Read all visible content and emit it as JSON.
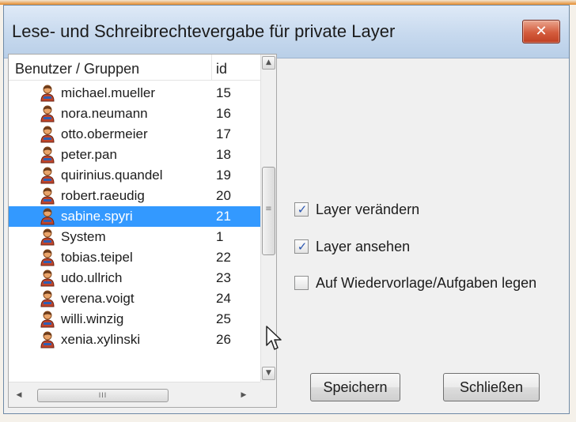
{
  "dialog": {
    "title": "Lese- und Schreibrechtevergabe für private Layer",
    "close_label": "✕"
  },
  "list": {
    "column_name": "Benutzer / Gruppen",
    "column_id": "id",
    "rows": [
      {
        "name": "michael.mueller",
        "id": "15",
        "selected": false
      },
      {
        "name": "nora.neumann",
        "id": "16",
        "selected": false
      },
      {
        "name": "otto.obermeier",
        "id": "17",
        "selected": false
      },
      {
        "name": "peter.pan",
        "id": "18",
        "selected": false
      },
      {
        "name": "quirinius.quandel",
        "id": "19",
        "selected": false
      },
      {
        "name": "robert.raeudig",
        "id": "20",
        "selected": false
      },
      {
        "name": "sabine.spyri",
        "id": "21",
        "selected": true
      },
      {
        "name": "System",
        "id": "1",
        "selected": false
      },
      {
        "name": "tobias.teipel",
        "id": "22",
        "selected": false
      },
      {
        "name": "udo.ullrich",
        "id": "23",
        "selected": false
      },
      {
        "name": "verena.voigt",
        "id": "24",
        "selected": false
      },
      {
        "name": "willi.winzig",
        "id": "25",
        "selected": false
      },
      {
        "name": "xenia.xylinski",
        "id": "26",
        "selected": false
      }
    ],
    "row_icon": "user-icon",
    "vscroll_grip": "≡",
    "hscroll_grip": "III"
  },
  "permissions": [
    {
      "label": "Layer verändern",
      "checked": true
    },
    {
      "label": "Layer ansehen",
      "checked": true
    },
    {
      "label": "Auf Wiedervorlage/Aufgaben legen",
      "checked": false
    }
  ],
  "buttons": {
    "save": "Speichern",
    "close": "Schließen"
  },
  "colors": {
    "selection": "#3399ff",
    "close_button": "#d45c3d",
    "check_mark": "#2a55b0"
  }
}
